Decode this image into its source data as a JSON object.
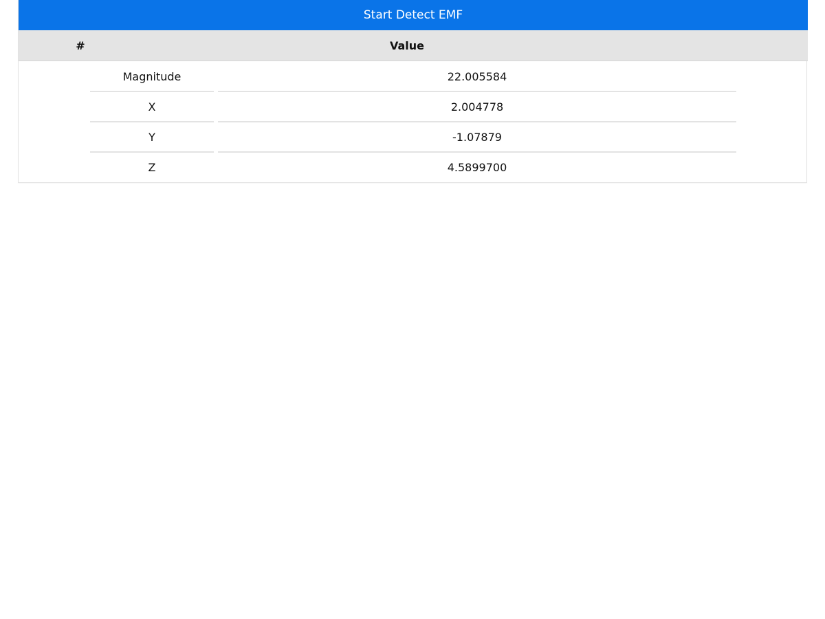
{
  "toolbar": {
    "start_label": "Start Detect EMF",
    "accent_color": "#0a74e8"
  },
  "table": {
    "columns": [
      "#",
      "Value"
    ],
    "rows": [
      {
        "name": "Magnitude",
        "value": "22.005584"
      },
      {
        "name": "X",
        "value": "2.004778"
      },
      {
        "name": "Y",
        "value": "-1.07879"
      },
      {
        "name": "Z",
        "value": "4.5899700"
      }
    ]
  }
}
